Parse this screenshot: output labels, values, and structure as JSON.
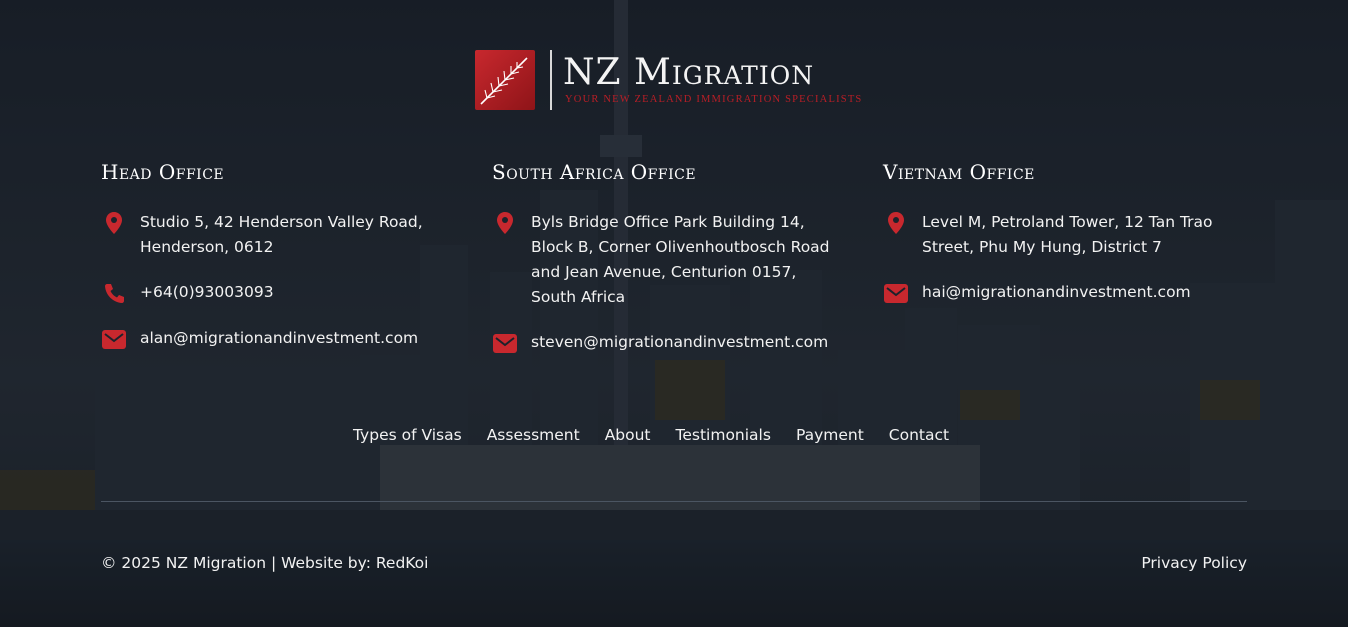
{
  "logo": {
    "title": "NZ Migration",
    "tagline": "YOUR NEW ZEALAND IMMIGRATION SPECIALISTS"
  },
  "offices": [
    {
      "heading": "Head Office",
      "address_lines": [
        "Studio 5, 42 Henderson Valley Road,",
        "Henderson, 0612"
      ],
      "phone": "+64(0)93003093",
      "email": "alan@migrationandinvestment.com"
    },
    {
      "heading": "South Africa Office",
      "address_lines": [
        "Byls Bridge Office Park Building 14,",
        "Block B, Corner Olivenhoutbosch Road",
        "and Jean Avenue, Centurion 0157,",
        "South Africa"
      ],
      "email": "steven@migrationandinvestment.com"
    },
    {
      "heading": "Vietnam Office",
      "address_lines": [
        "Level M, Petroland Tower, 12 Tan Trao",
        "Street, Phu My Hung, District 7"
      ],
      "email": "hai@migrationandinvestment.com"
    }
  ],
  "nav": [
    "Types of Visas",
    "Assessment",
    "About",
    "Testimonials",
    "Payment",
    "Contact"
  ],
  "footer": {
    "copyright": "© 2025 NZ Migration | Website by: RedKoi",
    "privacy": "Privacy Policy"
  },
  "colors": {
    "accent": "#c8282e",
    "background": "#1c222b"
  }
}
